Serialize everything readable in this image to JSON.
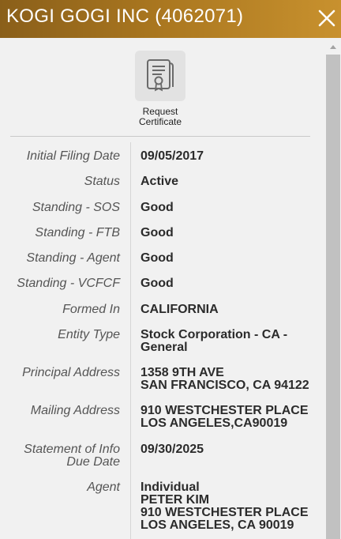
{
  "header": {
    "title": "KOGI GOGI INC (4062071)",
    "close_icon": "close-icon"
  },
  "actions": {
    "certificate_label_1": "Request",
    "certificate_label_2": "Certificate",
    "certificate_icon": "certificate-icon"
  },
  "details": [
    {
      "label": [
        "Initial Filing Date"
      ],
      "value": [
        "09/05/2017"
      ]
    },
    {
      "label": [
        "Status"
      ],
      "value": [
        "Active"
      ]
    },
    {
      "label": [
        "Standing - SOS"
      ],
      "value": [
        "Good"
      ]
    },
    {
      "label": [
        "Standing - FTB"
      ],
      "value": [
        "Good"
      ]
    },
    {
      "label": [
        "Standing - Agent"
      ],
      "value": [
        "Good"
      ]
    },
    {
      "label": [
        "Standing - VCFCF"
      ],
      "value": [
        "Good"
      ]
    },
    {
      "label": [
        "Formed In"
      ],
      "value": [
        "CALIFORNIA"
      ]
    },
    {
      "label": [
        "Entity Type"
      ],
      "value": [
        "Stock Corporation - CA -",
        "General"
      ]
    },
    {
      "label": [
        "Principal Address"
      ],
      "value": [
        "1358 9TH AVE",
        "SAN FRANCISCO, CA 94122"
      ]
    },
    {
      "label": [
        "Mailing Address"
      ],
      "value": [
        "910 WESTCHESTER PLACE",
        "LOS ANGELES,CA90019"
      ]
    },
    {
      "label": [
        "Statement of Info",
        "Due Date"
      ],
      "value": [
        "09/30/2025"
      ]
    },
    {
      "label": [
        "Agent"
      ],
      "value": [
        "Individual",
        "PETER KIM",
        "910 WESTCHESTER PLACE",
        "LOS ANGELES, CA  90019"
      ]
    }
  ],
  "colors": {
    "header_start": "#8a5f1a",
    "header_end": "#c8912e",
    "background": "#f1f1f1"
  }
}
